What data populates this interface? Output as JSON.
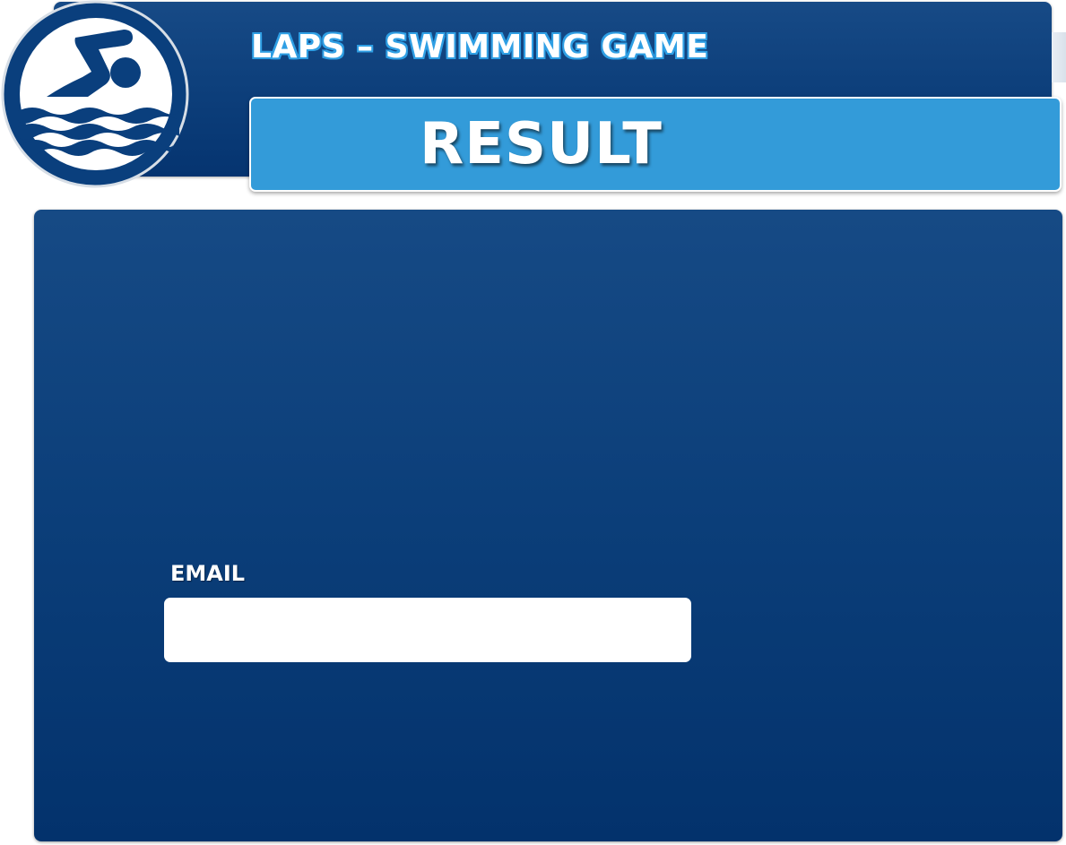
{
  "header": {
    "title": "LAPS – SWIMMING GAME",
    "logo_icon": "swimmer-icon"
  },
  "banner": {
    "title": "RESULT"
  },
  "form": {
    "email_label": "EMAIL",
    "email_value": "",
    "email_placeholder": ""
  },
  "colors": {
    "panel_navy": "#0b3e79",
    "banner_blue": "#339bd9",
    "title_outline": "#2f9fe4",
    "logo_navy": "#0a3f7d"
  }
}
